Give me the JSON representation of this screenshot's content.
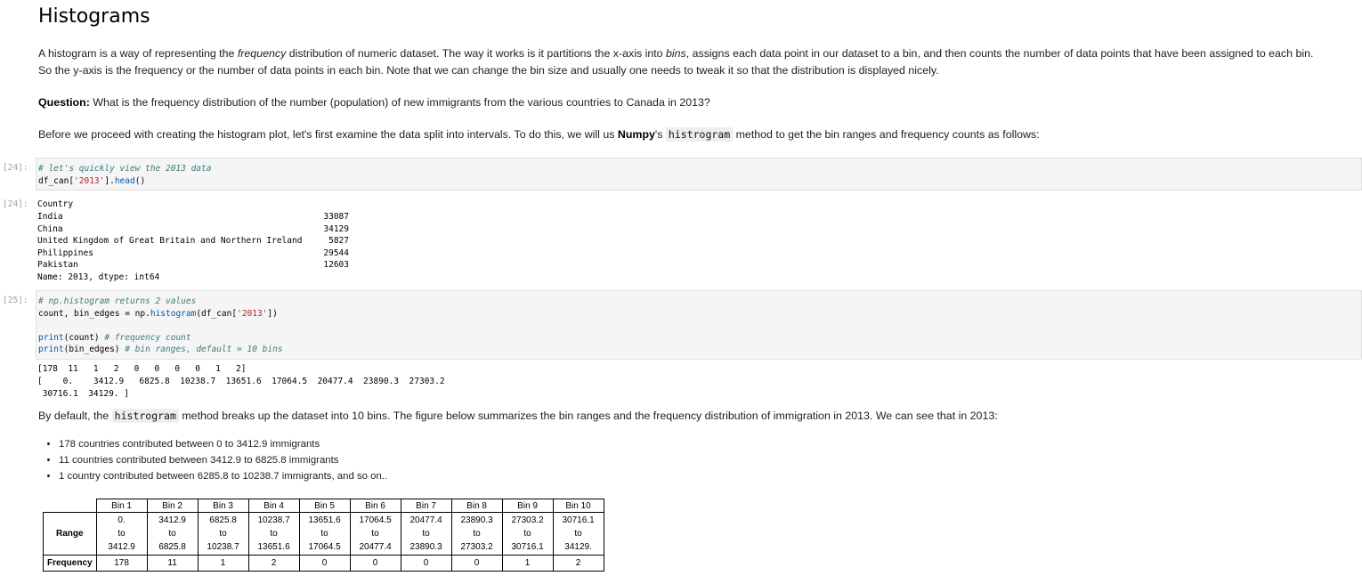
{
  "heading": "Histograms",
  "intro": {
    "p1_a": "A histogram is a way of representing the ",
    "p1_em1": "frequency",
    "p1_b": " distribution of numeric dataset. The way it works is it partitions the x-axis into ",
    "p1_em2": "bins",
    "p1_c": ", assigns each data point in our dataset to a bin, and then counts the number of data points that have been assigned to each bin.",
    "p1_line2": "So the y-axis is the frequency or the number of data points in each bin. Note that we can change the bin size and usually one needs to tweak it so that the distribution is displayed nicely."
  },
  "question": {
    "label": "Question:",
    "text": " What is the frequency distribution of the number (population) of new immigrants from the various countries to Canada in 2013?"
  },
  "before": {
    "a": "Before we proceed with creating the histogram plot, let's first examine the data split into intervals. To do this, we will us ",
    "bold": "Numpy",
    "b": "'s ",
    "code": "histrogram",
    "c": " method to get the bin ranges and frequency counts as follows:"
  },
  "cell24": {
    "prompt_in": "[24]:",
    "comment": "# let's quickly view the 2013 data",
    "code_a": "df_can[",
    "code_str": "'2013'",
    "code_b": "].",
    "code_fn": "head",
    "code_c": "()",
    "prompt_out": "[24]:",
    "out_header": "Country",
    "rows": [
      {
        "country": "India",
        "value": "33087"
      },
      {
        "country": "China",
        "value": "34129"
      },
      {
        "country": "United Kingdom of Great Britain and Northern Ireland",
        "value": "5827"
      },
      {
        "country": "Philippines",
        "value": "29544"
      },
      {
        "country": "Pakistan",
        "value": "12603"
      }
    ],
    "out_footer": "Name: 2013, dtype: int64"
  },
  "cell25": {
    "prompt_in": "[25]:",
    "comment1": "# np.histogram returns 2 values",
    "line2_a": "count, bin_edges = np.",
    "line2_fn": "histogram",
    "line2_b": "(df_can[",
    "line2_str": "'2013'",
    "line2_c": "])",
    "line4_a": "print",
    "line4_b": "(count) ",
    "line4_cm": "# frequency count",
    "line5_a": "print",
    "line5_b": "(bin_edges) ",
    "line5_cm": "# bin ranges, default = 10 bins",
    "out1": "[178  11   1   2   0   0   0   0   1   2]",
    "out2": "[    0.    3412.9   6825.8  10238.7  13651.6  17064.5  20477.4  23890.3  27303.2",
    "out3": " 30716.1  34129. ]"
  },
  "bydefault": {
    "a": "By default, the ",
    "code": "histrogram",
    "b": " method breaks up the dataset into 10 bins. The figure below summarizes the bin ranges and the frequency distribution of immigration in 2013. We can see that in 2013:"
  },
  "bullets": [
    "178 countries contributed between 0 to 3412.9 immigrants",
    "11 countries contributed between 3412.9 to 6825.8 immigrants",
    "1 country contributed between 6285.8 to 10238.7 immigrants, and so on.."
  ],
  "table": {
    "row_label_range": "Range",
    "row_label_freq": "Frequency",
    "to_word": "to",
    "bins": [
      {
        "name": "Bin 1",
        "from": "0.",
        "to": "3412.9",
        "freq": "178"
      },
      {
        "name": "Bin 2",
        "from": "3412.9",
        "to": "6825.8",
        "freq": "11"
      },
      {
        "name": "Bin 3",
        "from": "6825.8",
        "to": "10238.7",
        "freq": "1"
      },
      {
        "name": "Bin 4",
        "from": "10238.7",
        "to": "13651.6",
        "freq": "2"
      },
      {
        "name": "Bin 5",
        "from": "13651.6",
        "to": "17064.5",
        "freq": "0"
      },
      {
        "name": "Bin 6",
        "from": "17064.5",
        "to": "20477.4",
        "freq": "0"
      },
      {
        "name": "Bin 7",
        "from": "20477.4",
        "to": "23890.3",
        "freq": "0"
      },
      {
        "name": "Bin 8",
        "from": "23890.3",
        "to": "27303.2",
        "freq": "0"
      },
      {
        "name": "Bin 9",
        "from": "27303.2",
        "to": "30716.1",
        "freq": "1"
      },
      {
        "name": "Bin 10",
        "from": "30716.1",
        "to": "34129.",
        "freq": "2"
      }
    ]
  }
}
